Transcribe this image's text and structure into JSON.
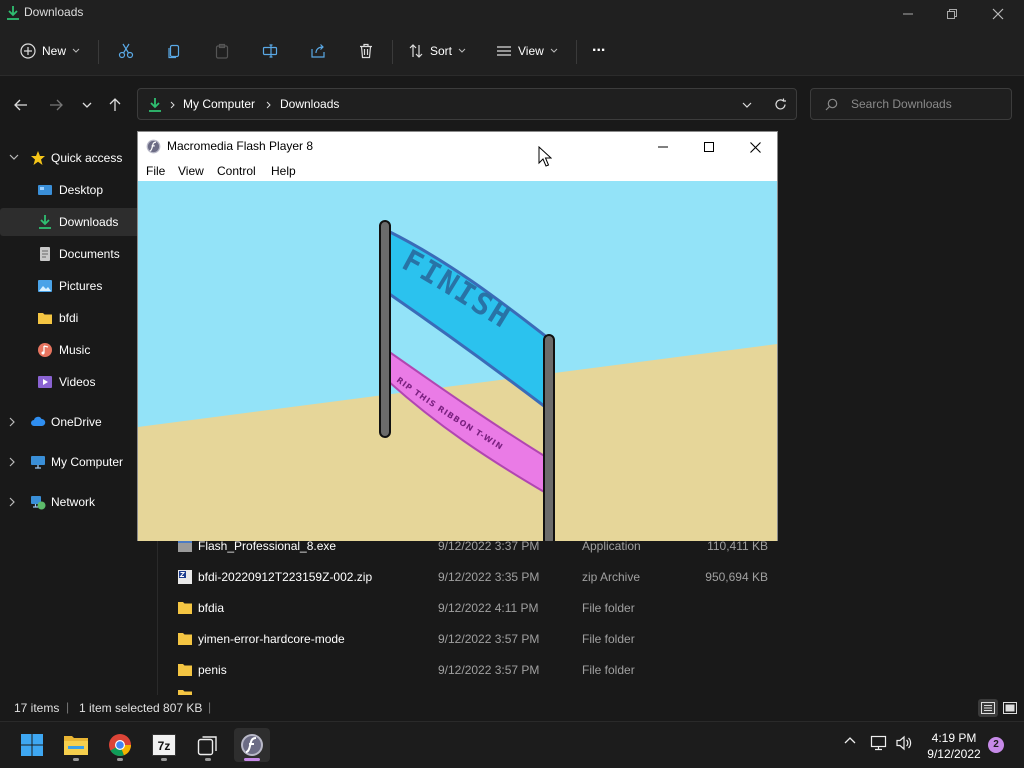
{
  "explorer": {
    "title": "Downloads",
    "toolbar": {
      "new_label": "New",
      "sort_label": "Sort",
      "view_label": "View",
      "more_label": "..."
    },
    "address": {
      "crumbs": [
        "My Computer",
        "Downloads"
      ]
    },
    "search": {
      "placeholder": "Search Downloads"
    },
    "sidebar": {
      "items": [
        {
          "label": "Quick access",
          "icon": "star-icon"
        },
        {
          "label": "Desktop",
          "icon": "desktop-icon"
        },
        {
          "label": "Downloads",
          "icon": "download-icon",
          "selected": true
        },
        {
          "label": "Documents",
          "icon": "documents-icon"
        },
        {
          "label": "Pictures",
          "icon": "pictures-icon"
        },
        {
          "label": "bfdi",
          "icon": "folder-icon"
        },
        {
          "label": "Music",
          "icon": "music-icon"
        },
        {
          "label": "Videos",
          "icon": "videos-icon"
        },
        {
          "label": "OneDrive",
          "icon": "cloud-icon"
        },
        {
          "label": "My Computer",
          "icon": "computer-icon"
        },
        {
          "label": "Network",
          "icon": "network-icon"
        }
      ]
    },
    "files": [
      {
        "name": "Flash_Professional_8.exe",
        "date": "9/12/2022 3:37 PM",
        "type": "Application",
        "size": "110,411 KB",
        "icon": "exe-icon"
      },
      {
        "name": "bfdi-20220912T223159Z-002.zip",
        "date": "9/12/2022 3:35 PM",
        "type": "zip Archive",
        "size": "950,694 KB",
        "icon": "zip-icon"
      },
      {
        "name": "bfdia",
        "date": "9/12/2022 4:11 PM",
        "type": "File folder",
        "size": "",
        "icon": "folder-icon"
      },
      {
        "name": "yimen-error-hardcore-mode",
        "date": "9/12/2022 3:57 PM",
        "type": "File folder",
        "size": "",
        "icon": "folder-icon"
      },
      {
        "name": "penis",
        "date": "9/12/2022 3:57 PM",
        "type": "File folder",
        "size": "",
        "icon": "folder-icon"
      }
    ],
    "status": {
      "count": "17 items",
      "selected": "1 item selected  807 KB"
    }
  },
  "flash": {
    "title": "Macromedia Flash Player 8",
    "menu": [
      "File",
      "View",
      "Control",
      "Help"
    ],
    "banner_text": "FINISH",
    "ribbon_text": "RIP THIS RIBBON T-WIN",
    "colors": {
      "sky": "#93e3f8",
      "ground": "#e6d699",
      "banner": "#2bc2ee",
      "ribbon": "#ea7be6"
    }
  },
  "taskbar": {
    "apps": [
      "start-icon",
      "file-explorer-icon",
      "chrome-icon",
      "7zip-icon",
      "task-view-icon",
      "flash-player-icon"
    ],
    "time": "4:19 PM",
    "date": "9/12/2022",
    "notifications": "2"
  }
}
